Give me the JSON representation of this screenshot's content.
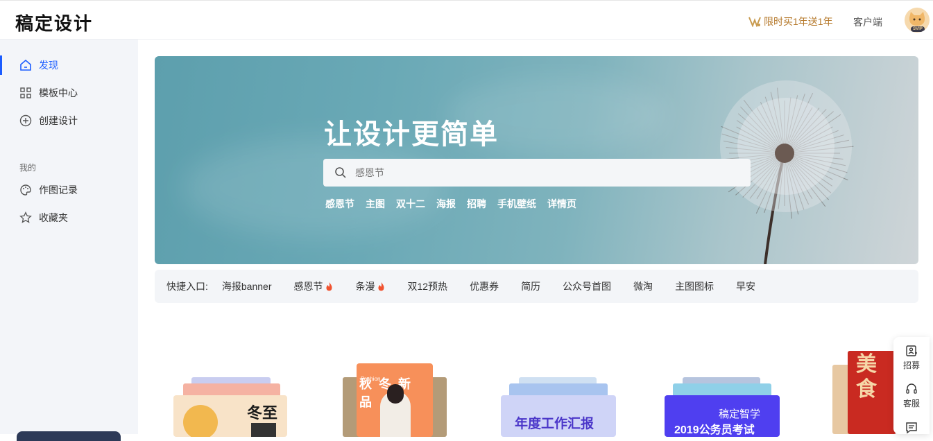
{
  "header": {
    "logo": "稿定设计",
    "promo": "限时买1年送1年",
    "client": "客户端",
    "avatar_badge": "SVIP"
  },
  "sidebar": {
    "items": [
      {
        "label": "发现",
        "icon": "home-icon",
        "active": true
      },
      {
        "label": "模板中心",
        "icon": "grid-icon",
        "active": false
      },
      {
        "label": "创建设计",
        "icon": "plus-circle-icon",
        "active": false
      }
    ],
    "section_title": "我的",
    "my_items": [
      {
        "label": "作图记录",
        "icon": "palette-icon"
      },
      {
        "label": "收藏夹",
        "icon": "star-icon"
      }
    ]
  },
  "banner": {
    "title": "让设计更简单",
    "search_placeholder": "感恩节",
    "hot_tags": [
      "感恩节",
      "主图",
      "双十二",
      "海报",
      "招聘",
      "手机壁纸",
      "详情页"
    ]
  },
  "shortcut": {
    "label": "快捷入口:",
    "items": [
      {
        "label": "海报banner",
        "hot": false
      },
      {
        "label": "感恩节",
        "hot": true
      },
      {
        "label": "条漫",
        "hot": true
      },
      {
        "label": "双12预热",
        "hot": false
      },
      {
        "label": "优惠券",
        "hot": false
      },
      {
        "label": "简历",
        "hot": false
      },
      {
        "label": "公众号首图",
        "hot": false
      },
      {
        "label": "微淘",
        "hot": false
      },
      {
        "label": "主图图标",
        "hot": false
      },
      {
        "label": "早安",
        "hot": false
      }
    ]
  },
  "cards": [
    {
      "text": "冬至"
    },
    {
      "text": "秋冬新品",
      "small": "Fashion"
    },
    {
      "text": "年度工作汇报"
    },
    {
      "text": "稿定智学",
      "sub": "2019公务员考试"
    },
    {
      "text": "美食"
    }
  ],
  "float_bar": {
    "items": [
      {
        "label": "招募",
        "icon": "recruit-icon"
      },
      {
        "label": "客服",
        "icon": "headset-icon"
      },
      {
        "label": "",
        "icon": "message-icon"
      }
    ]
  },
  "colors": {
    "accent": "#1b5cff",
    "promo": "#b5782a",
    "sidebar_bg": "#f3f5f9"
  }
}
